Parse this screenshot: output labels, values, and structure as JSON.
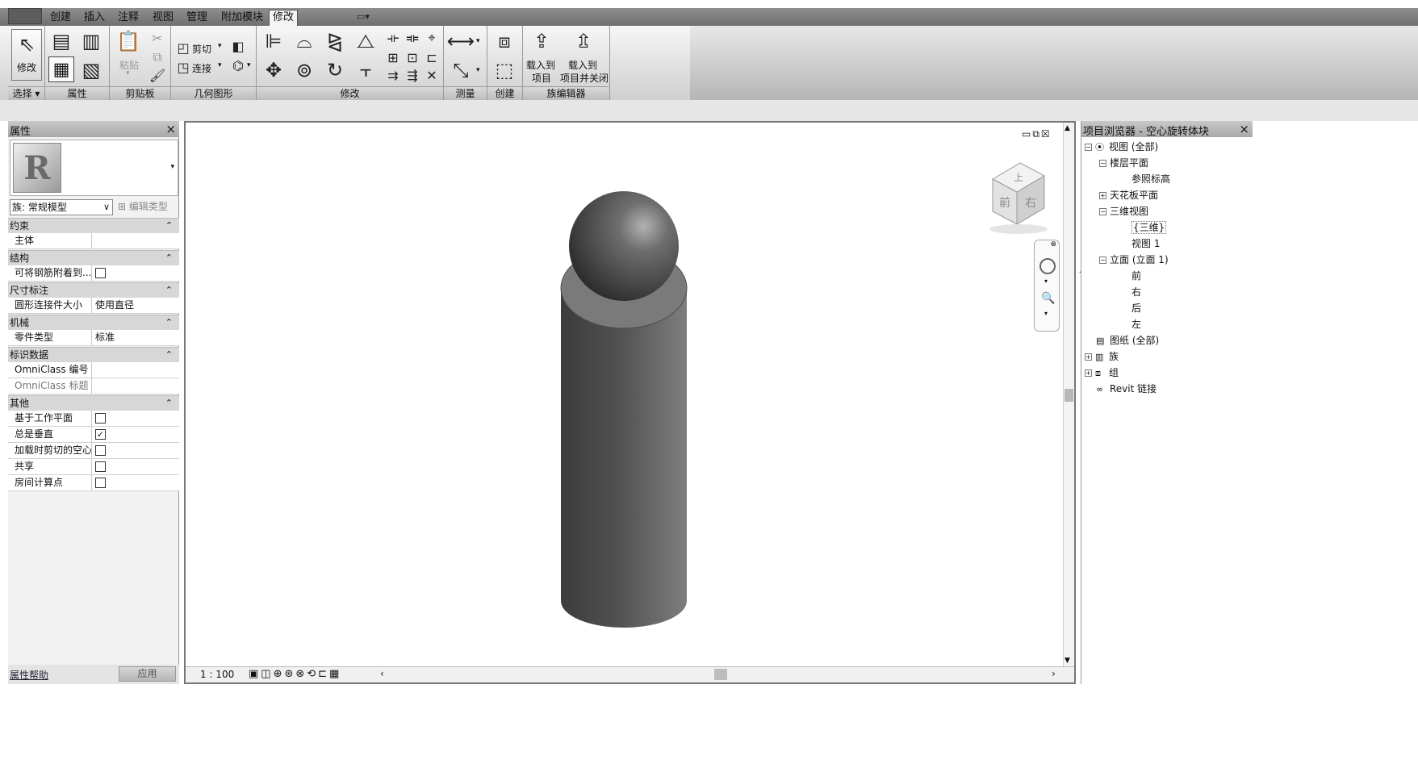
{
  "tabs": [
    "创建",
    "插入",
    "注释",
    "视图",
    "管理",
    "附加模块",
    "修改"
  ],
  "active_tab": "修改",
  "ribbon": {
    "select_button": "修改",
    "select_panel": "选择",
    "panels": [
      "属性",
      "剪贴板",
      "几何图形",
      "修改",
      "测量",
      "创建",
      "族编辑器"
    ],
    "paste": "粘贴",
    "cut": "剪切",
    "join": "连接",
    "load_project_line1": "载入到",
    "load_project_line2": "项目",
    "load_close_line1": "载入到",
    "load_close_line2": "项目并关闭"
  },
  "properties": {
    "title": "属性",
    "family": "族: 常规模型",
    "edit_type": "编辑类型",
    "groups": {
      "constraints": "约束",
      "structure": "结构",
      "dimensions": "尺寸标注",
      "mechanical": "机械",
      "identity": "标识数据",
      "other": "其他"
    },
    "rows": {
      "host": "主体",
      "rebar": "可将钢筋附着到...",
      "connector_size": "圆形连接件大小",
      "connector_value": "使用直径",
      "part_type": "零件类型",
      "part_value": "标准",
      "omni_number": "OmniClass 编号",
      "omni_title": "OmniClass 标题",
      "work_plane": "基于工作平面",
      "always_vertical": "总是垂直",
      "cut_voids": "加载时剪切的空心",
      "shared": "共享",
      "room_point": "房间计算点"
    },
    "help": "属性帮助",
    "apply": "应用"
  },
  "view": {
    "scale": "1 : 100",
    "cube_top": "上",
    "cube_front": "前",
    "cube_right": "右"
  },
  "browser": {
    "title": "项目浏览器 - 空心旋转体块",
    "items": [
      "视图 (全部)",
      "楼层平面",
      "参照标高",
      "天花板平面",
      "三维视图",
      "{三维}",
      "视图 1",
      "立面 (立面 1)",
      "前",
      "右",
      "后",
      "左",
      "图纸 (全部)",
      "族",
      "组",
      "Revit 链接"
    ]
  },
  "colors": {
    "annotation_arrow": "#e0197b",
    "ribbon_bg": "#e0e0e0",
    "panel_header": "#b0b0b0"
  }
}
